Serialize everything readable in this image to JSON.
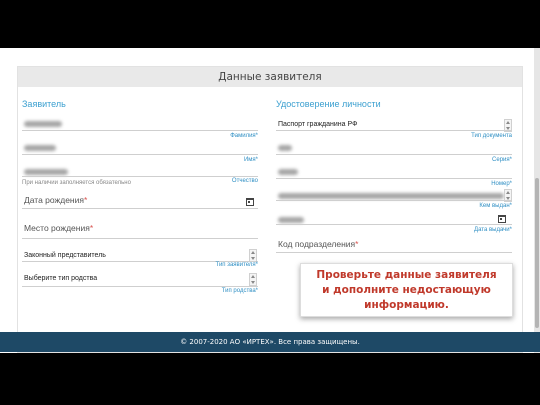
{
  "form": {
    "header_title": "Данные заявителя",
    "applicant": {
      "title": "Заявитель",
      "surname_hint": "Фамилия*",
      "name_hint": "Имя*",
      "patronymic_note": "При наличии заполняется обязательно",
      "patronymic_hint": "Отчество",
      "birth_date_label": "Дата рождения",
      "birth_place_label": "Место рождения",
      "required_mark": "*",
      "applicant_type_value": "Законный представитель",
      "applicant_type_hint": "Тип заявителя*",
      "kinship_value": "Выберите тип родства",
      "kinship_hint": "Тип родства*"
    },
    "identity": {
      "title": "Удостоверение личности",
      "doc_type_value": "Паспорт гражданина РФ",
      "doc_type_hint": "Тип документа",
      "series_hint": "Серия*",
      "number_hint": "Номер*",
      "issued_by_hint": "Кем выдан*",
      "issue_date_hint": "Дата выдачи*",
      "subdivision_label": "Код подразделения",
      "required_mark": "*"
    }
  },
  "footer": {
    "copyright": "© 2007-2020 АО «ИРТЕХ». Все права защищены."
  },
  "callout": {
    "line1": "Проверьте данные заявителя",
    "line2": "и дополните недостающую",
    "line3": "информацию."
  },
  "colors": {
    "accent": "#3ca0d0",
    "footer_bg": "#1e4966",
    "callout_text": "#c0392b",
    "required": "#d9534f"
  }
}
